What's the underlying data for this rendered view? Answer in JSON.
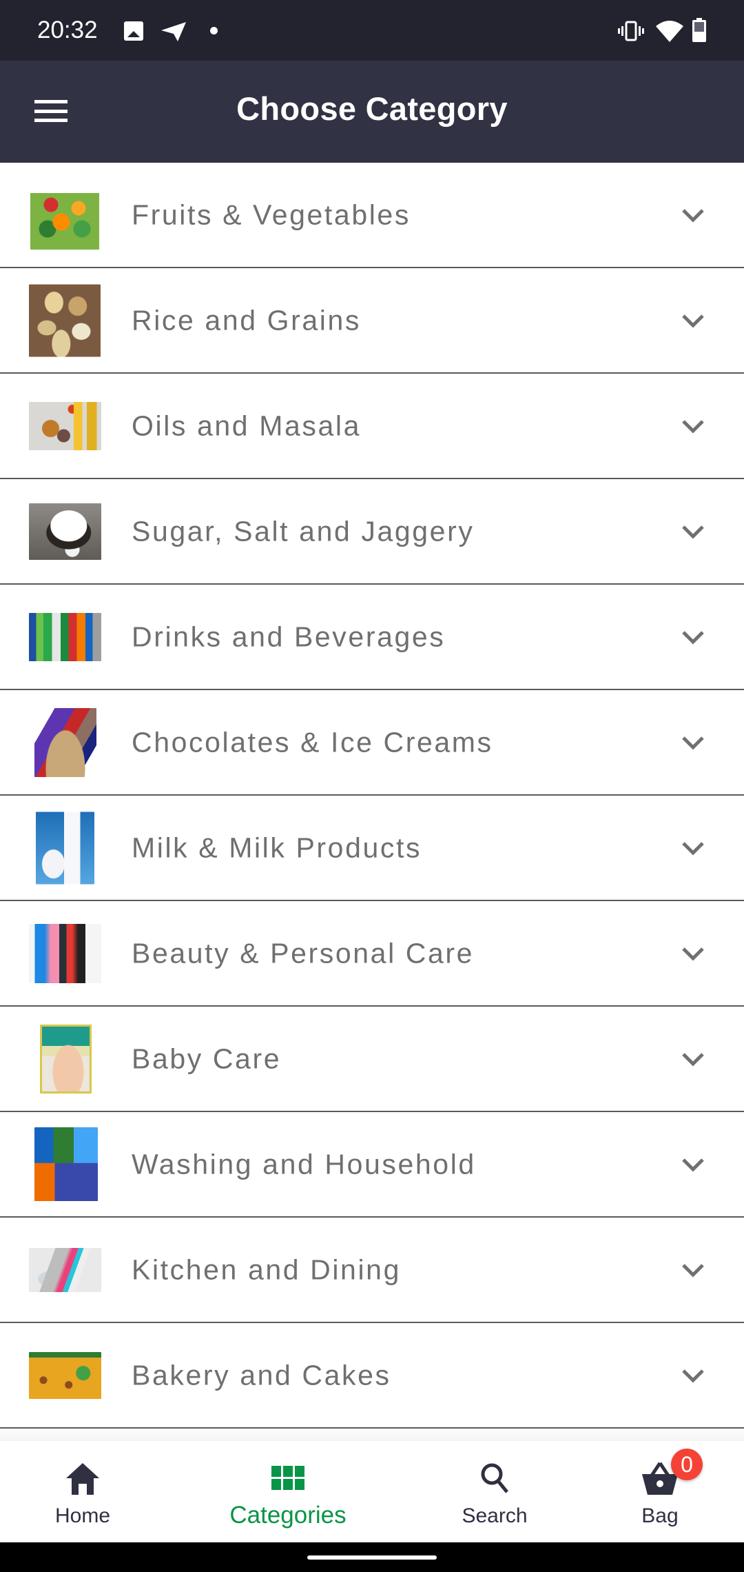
{
  "status_bar": {
    "time": "20:32",
    "left_icons": [
      "gallery-icon",
      "telegram-icon",
      "notification-dot"
    ],
    "right_icons": [
      "vibrate-icon",
      "wifi-icon",
      "battery-icon"
    ]
  },
  "app_bar": {
    "title": "Choose Category",
    "menu_icon": "hamburger-menu-icon"
  },
  "categories": [
    {
      "label": "Fruits & Vegetables",
      "image": "fruits-vegetables-basket",
      "expand_icon": "chevron-down-icon"
    },
    {
      "label": "Rice and Grains",
      "image": "rice-grains-bowls",
      "expand_icon": "chevron-down-icon"
    },
    {
      "label": "Oils and Masala",
      "image": "oils-spices",
      "expand_icon": "chevron-down-icon"
    },
    {
      "label": "Sugar, Salt and Jaggery",
      "image": "sugar-bowl",
      "expand_icon": "chevron-down-icon"
    },
    {
      "label": "Drinks and Beverages",
      "image": "soft-drink-bottles",
      "expand_icon": "chevron-down-icon"
    },
    {
      "label": "Chocolates & Ice Creams",
      "image": "chocolate-basket",
      "expand_icon": "chevron-down-icon"
    },
    {
      "label": "Milk & Milk Products",
      "image": "milk-jug-bottle",
      "expand_icon": "chevron-down-icon"
    },
    {
      "label": "Beauty & Personal Care",
      "image": "personal-care-products",
      "expand_icon": "chevron-down-icon"
    },
    {
      "label": "Baby Care",
      "image": "diaper-pack",
      "expand_icon": "chevron-down-icon"
    },
    {
      "label": "Washing and Household",
      "image": "detergent-products",
      "expand_icon": "chevron-down-icon"
    },
    {
      "label": "Kitchen and Dining",
      "image": "kitchen-utensils",
      "expand_icon": "chevron-down-icon"
    },
    {
      "label": "Bakery and Cakes",
      "image": "namkeen-snack",
      "expand_icon": "chevron-down-icon"
    }
  ],
  "bottom_nav": {
    "items": [
      {
        "label": "Home",
        "icon": "home-icon",
        "active": false
      },
      {
        "label": "Categories",
        "icon": "grid-icon",
        "active": true
      },
      {
        "label": "Search",
        "icon": "search-icon",
        "active": false
      },
      {
        "label": "Bag",
        "icon": "shopping-basket-icon",
        "active": false
      }
    ],
    "bag_badge_count": "0"
  },
  "colors": {
    "status_bar": "#23232f",
    "app_bar": "#313244",
    "label_text": "#6f6f6f",
    "divider": "#5a5a5a",
    "nav_active": "#0a9447",
    "nav_inactive": "#2f3042",
    "badge": "#f44336"
  }
}
